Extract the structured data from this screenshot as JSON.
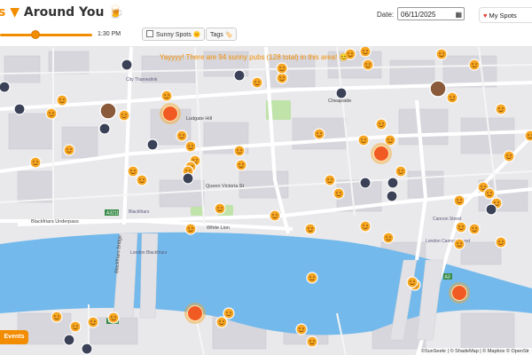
{
  "header": {
    "title_prefix": "s",
    "title_accent": "▼",
    "title_main": "Around You",
    "title_emoji": "🍺",
    "date_label": "Date:",
    "date_value": "06/11/2025",
    "my_spots_label": "My Spots",
    "time_value": "1:30 PM",
    "time_fraction": 0.38,
    "sunny_spots_label": "Sunny Spots 🌞",
    "tags_label": "Tags 🏷️"
  },
  "map": {
    "banner": "Yayyyy! There are 94 sunny pubs (128 total) in this area! 😊",
    "events_label": "Events",
    "attribution": "©SunSeekr | © ShadeMap | © Mapbox © OpenStr",
    "place_labels": {
      "city_thameslink": "City Thameslink",
      "blackfriars": "Blackfriars",
      "london_blackfriars": "London Blackfriars",
      "blackfriars_underpass": "Blackfriars Underpass",
      "blackfriars_bridge": "Blackfriars Bridge",
      "white_lion": "White Lion",
      "queen_victoria_st": "Queen Victoria St",
      "cannon_street": "Cannon Street",
      "london_cannon_street": "London Cannon Street",
      "cheapside": "Cheapside",
      "ludgate": "Ludgate Hill",
      "a3211": "A3211",
      "a201": "A201",
      "a3": "A3"
    },
    "colors": {
      "sunny_pin": "#f6a623",
      "shade_pin": "#3b4258",
      "featured_pin": "#f15a22",
      "water": "#73b9eb",
      "park": "#bfe3a8"
    }
  }
}
